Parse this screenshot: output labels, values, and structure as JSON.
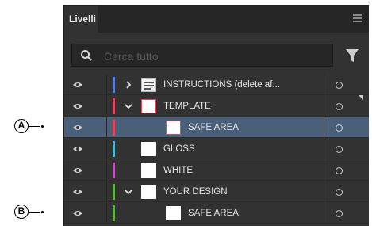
{
  "panel": {
    "tab_label": "Livelli",
    "search_placeholder": "Cerca tutto"
  },
  "layers": [
    {
      "label": "INSTRUCTIONS (delete af...",
      "color": "#5b7bd6",
      "indent": 0,
      "expander": "collapsed",
      "thumb": "instructions",
      "selected": false
    },
    {
      "label": "TEMPLATE",
      "color": "#e0475a",
      "indent": 0,
      "expander": "expanded",
      "thumb": "red-border",
      "selected": false
    },
    {
      "label": "SAFE AREA",
      "color": "#e0475a",
      "indent": 1,
      "expander": "none",
      "thumb": "red-border",
      "selected": true
    },
    {
      "label": "GLOSS",
      "color": "#4fb7d6",
      "indent": 0,
      "expander": "none",
      "thumb": "plain",
      "selected": false
    },
    {
      "label": "WHITE",
      "color": "#b55cb7",
      "indent": 0,
      "expander": "none",
      "thumb": "plain",
      "selected": false
    },
    {
      "label": "YOUR DESIGN",
      "color": "#62b246",
      "indent": 0,
      "expander": "expanded",
      "thumb": "plain",
      "selected": false
    },
    {
      "label": "SAFE AREA",
      "color": "#62b246",
      "indent": 1,
      "expander": "none",
      "thumb": "plain",
      "selected": false
    }
  ],
  "callouts": [
    {
      "letter": "A"
    },
    {
      "letter": "B"
    }
  ],
  "icons": {
    "visibility": "eye-icon",
    "expand": "chevron-icon",
    "search": "search-icon",
    "filter": "filter-icon",
    "target": "target-circle-icon",
    "menu": "panel-menu-icon"
  }
}
